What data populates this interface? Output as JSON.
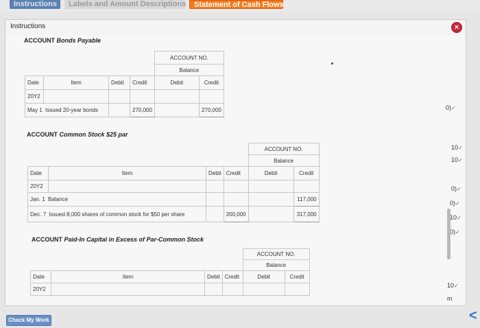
{
  "tabs": [
    "Instructions",
    "Labels and Amount Descriptions",
    "Statement of Cash Flows"
  ],
  "panel": {
    "title": "Instructions",
    "close_glyph": "×"
  },
  "accounts": [
    {
      "title": "Bonds Payable",
      "header": {
        "account_no": "ACCOUNT NO.",
        "balance": "Balance",
        "date": "Date",
        "item": "Item",
        "debit": "Debit",
        "credit": "Credit"
      },
      "year": "20Y2",
      "rows": [
        {
          "month": "May",
          "day": "1",
          "item": "Issued 20-year bonds",
          "debit": "",
          "credit": "270,000",
          "bal_debit": "",
          "bal_credit": "270,000"
        }
      ]
    },
    {
      "title": "Common Stock $25 par",
      "header": {
        "account_no": "ACCOUNT NO.",
        "balance": "Balance",
        "date": "Date",
        "item": "Item",
        "debit": "Debit",
        "credit": "Credit"
      },
      "year": "20Y2",
      "rows": [
        {
          "month": "Jan.",
          "day": "1",
          "item": "Balance",
          "debit": "",
          "credit": "",
          "bal_debit": "",
          "bal_credit": "117,000"
        },
        {
          "month": "Dec.",
          "day": "7",
          "item": "Issued 8,000 shares of common stock for $50 per share",
          "debit": "",
          "credit": "200,000",
          "bal_debit": "",
          "bal_credit": "317,000"
        }
      ]
    },
    {
      "title": "Paid-In Capital in Excess of Par-Common Stock",
      "header": {
        "account_no": "ACCOUNT NO.",
        "balance": "Balance",
        "date": "Date",
        "item": "Item",
        "debit": "Debit",
        "credit": "Credit"
      },
      "year": "20Y2"
    }
  ],
  "account_prefix": "ACCOUNT",
  "gutter_marks": [
    "0)",
    "10",
    "10",
    "0)",
    "0)",
    "10",
    "0)",
    "10",
    "m"
  ],
  "check_button": "Check My Work",
  "back_glyph": "<"
}
